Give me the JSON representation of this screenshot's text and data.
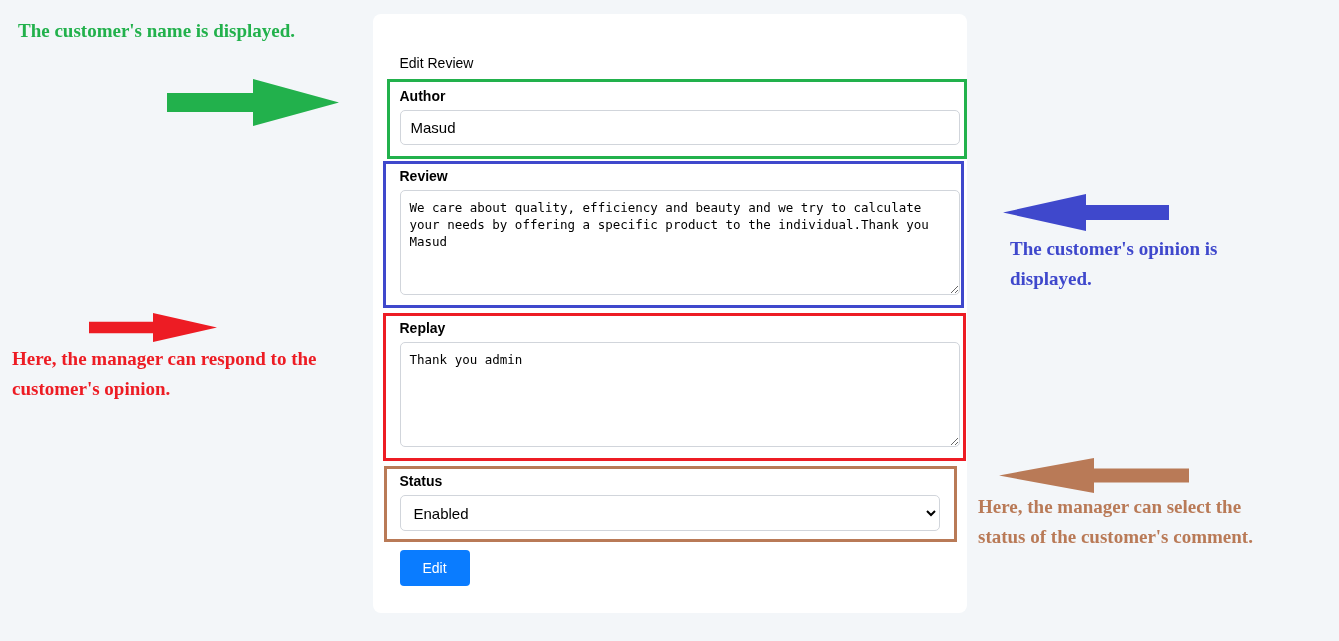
{
  "form": {
    "title": "Edit Review",
    "fields": [
      {
        "kind": "input",
        "label": "Author",
        "value": "Masud",
        "color": "#22b14c"
      },
      {
        "kind": "textarea",
        "label": "Review",
        "value": "We care about quality, efficiency and beauty and we try to calculate your needs by offering a specific product to the individual.Thank you Masud",
        "color": "#3f48cc"
      },
      {
        "kind": "textarea",
        "label": "Replay",
        "value": "Thank you admin",
        "color": "#ed1c24"
      },
      {
        "kind": "select",
        "label": "Status",
        "value": "Enabled",
        "color": "#b97a57"
      }
    ],
    "submit": "Edit"
  },
  "annotations": [
    {
      "text": "The customer's name is displayed.",
      "color": "#22b14c",
      "kind": "right"
    },
    {
      "text": "The customer's opinion is displayed.",
      "color": "#3f48cc",
      "kind": "left"
    },
    {
      "text": "Here, the manager can respond to the customer's opinion.",
      "color": "#ed1c24",
      "kind": "right"
    },
    {
      "text": "Here, the manager can select the status of the customer's comment.",
      "color": "#b97a57",
      "kind": "left"
    }
  ]
}
